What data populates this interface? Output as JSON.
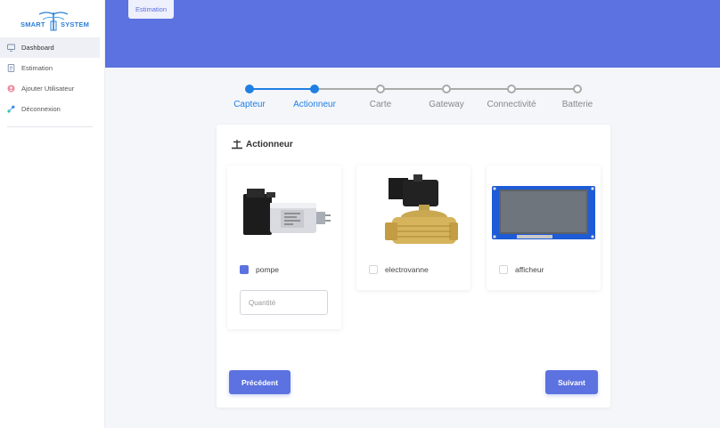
{
  "app": {
    "logo_left": "SMART",
    "logo_right": "SYSTEM"
  },
  "sidebar": {
    "items": [
      {
        "label": "Dashboard",
        "icon": "monitor-icon"
      },
      {
        "label": "Estimation",
        "icon": "document-icon"
      },
      {
        "label": "Ajouter Utilisateur",
        "icon": "user-add-icon"
      },
      {
        "label": "Déconnexion",
        "icon": "logout-icon"
      }
    ]
  },
  "header": {
    "tab_label": "Estimation"
  },
  "stepper": {
    "steps": [
      {
        "label": "Capteur",
        "state": "done"
      },
      {
        "label": "Actionneur",
        "state": "done"
      },
      {
        "label": "Carte",
        "state": "todo"
      },
      {
        "label": "Gateway",
        "state": "todo"
      },
      {
        "label": "Connectivité",
        "state": "todo"
      },
      {
        "label": "Batterie",
        "state": "todo"
      }
    ]
  },
  "section": {
    "title": "Actionneur"
  },
  "products": [
    {
      "label": "pompe",
      "checked": true,
      "quantity_placeholder": "Quantité"
    },
    {
      "label": "electrovanne",
      "checked": false
    },
    {
      "label": "afficheur",
      "checked": false
    }
  ],
  "buttons": {
    "previous": "Précédent",
    "next": "Suivant"
  },
  "colors": {
    "accent": "#5c72e0",
    "step_active": "#1f7fe3",
    "step_inactive": "#aaaaaa"
  }
}
